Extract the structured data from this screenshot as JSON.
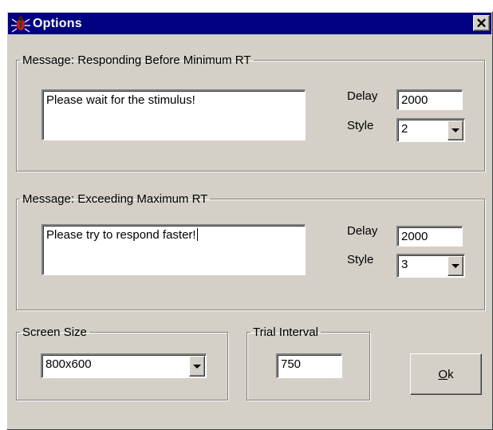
{
  "window": {
    "title": "Options",
    "icon": "insect-icon",
    "close_label": "✕"
  },
  "group1": {
    "legend": "Message: Responding Before Minimum RT",
    "message": "Please wait for the stimulus!",
    "delay_label": "Delay",
    "delay_value": "2000",
    "style_label": "Style",
    "style_value": "2"
  },
  "group2": {
    "legend": "Message: Exceeding Maximum RT",
    "message": "Please try to respond faster!",
    "delay_label": "Delay",
    "delay_value": "2000",
    "style_label": "Style",
    "style_value": "3"
  },
  "screen_size": {
    "legend": "Screen Size",
    "value": "800x600"
  },
  "trial_interval": {
    "legend": "Trial Interval",
    "value": "750"
  },
  "ok_button": {
    "accel": "O",
    "rest": "k"
  },
  "colors": {
    "titlebar": "#000080",
    "face": "#d4d0c8"
  }
}
